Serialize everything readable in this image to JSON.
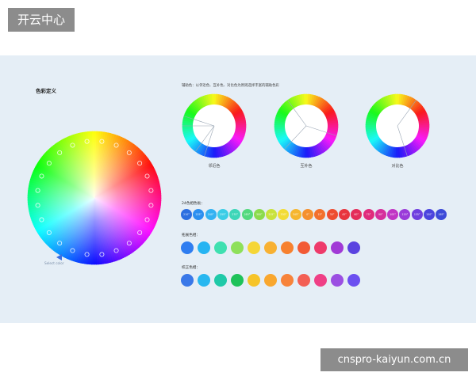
{
  "watermark": {
    "top": "开云中心",
    "bottom": "cnspro-kaiyun.com.cn"
  },
  "section_title": "色彩定义",
  "aux_note": "辅助色：以邻近色、互补色、对比色为原则选择丰富的辅助色彩",
  "main_wheel": {
    "caption": "Select color"
  },
  "wheels": [
    {
      "label": "邻近色",
      "spokes": [
        0.55,
        0.6,
        0.75,
        0.8
      ]
    },
    {
      "label": "互补色",
      "spokes": [
        0.3,
        0.62,
        0.9
      ]
    },
    {
      "label": "对比色",
      "spokes": [
        0.1,
        0.45
      ]
    }
  ],
  "palette24": {
    "label": "24色相色板：",
    "chips": [
      {
        "text": "210°",
        "color": "#2d6fe0"
      },
      {
        "text": "225°",
        "color": "#2b8ff0"
      },
      {
        "text": "240°",
        "color": "#33b2f2"
      },
      {
        "text": "255°",
        "color": "#3ccde6"
      },
      {
        "text": "270°",
        "color": "#3dd6b8"
      },
      {
        "text": "285°",
        "color": "#53d97e"
      },
      {
        "text": "300°",
        "color": "#8bdb4c"
      },
      {
        "text": "315°",
        "color": "#c9e23c"
      },
      {
        "text": "330°",
        "color": "#f2dc36"
      },
      {
        "text": "345°",
        "color": "#f6b62f"
      },
      {
        "text": "0°",
        "color": "#f5902d"
      },
      {
        "text": "15°",
        "color": "#f3702c"
      },
      {
        "text": "30°",
        "color": "#ee4d30"
      },
      {
        "text": "45°",
        "color": "#e8353e"
      },
      {
        "text": "60°",
        "color": "#e42d5a"
      },
      {
        "text": "75°",
        "color": "#e02b7c"
      },
      {
        "text": "90°",
        "color": "#d62e9c"
      },
      {
        "text": "105°",
        "color": "#c135c4"
      },
      {
        "text": "120°",
        "color": "#9a3bd9"
      },
      {
        "text": "135°",
        "color": "#6f3fdf"
      },
      {
        "text": "150°",
        "color": "#4b44de"
      },
      {
        "text": "165°",
        "color": "#3d4bd8"
      }
    ]
  },
  "extended": {
    "label": "拓展色相：",
    "colors": [
      "#2f7df0",
      "#26b4f2",
      "#3fe0b0",
      "#8ee05a",
      "#f5d637",
      "#f8b132",
      "#f7812f",
      "#f25a35",
      "#ee3a6a",
      "#a13ad6",
      "#5a43e0"
    ]
  },
  "corrected": {
    "label": "校正色相：",
    "colors": [
      "#3a78e8",
      "#28b7f0",
      "#1fc9a8",
      "#1fc25a",
      "#f6c429",
      "#f9a72e",
      "#f7833a",
      "#f35f54",
      "#ef3f86",
      "#9b4fe2",
      "#6b4ff0"
    ]
  }
}
